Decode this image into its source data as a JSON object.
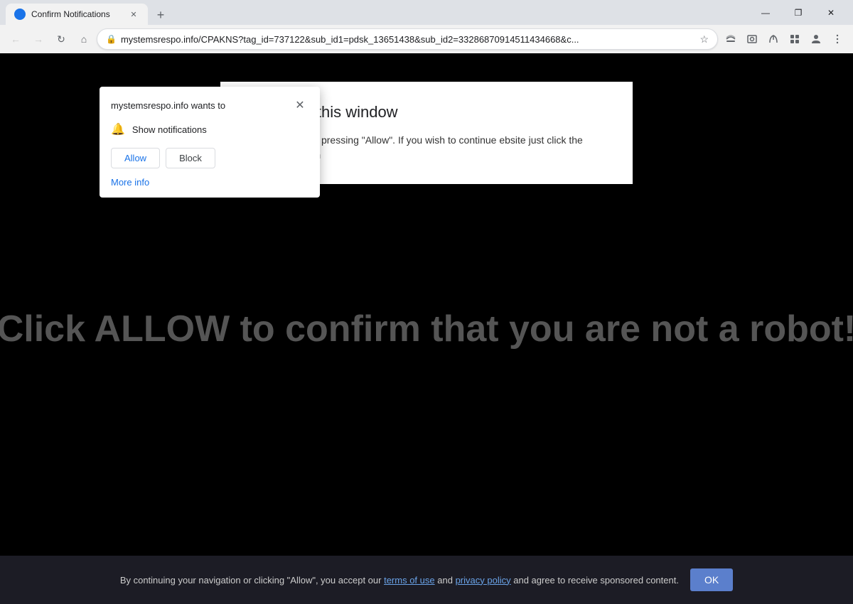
{
  "browser": {
    "tab_title": "Confirm Notifications",
    "tab_favicon": "circle",
    "url": "mystemsrespo.info/CPAKNS?tag_id=737122&sub_id1=pdsk_13651438&sub_id2=33286870914511434668&c...",
    "new_tab_label": "+",
    "win_minimize": "—",
    "win_maximize": "❐",
    "win_close": "✕"
  },
  "nav": {
    "back_icon": "←",
    "forward_icon": "→",
    "refresh_icon": "↻",
    "home_icon": "⌂",
    "lock_icon": "🔒",
    "star_icon": "☆"
  },
  "nav_icons": [
    {
      "name": "cast-icon",
      "glyph": "⬡"
    },
    {
      "name": "screenshot-icon",
      "glyph": "⬚"
    },
    {
      "name": "extensions-icon",
      "glyph": "⬡"
    },
    {
      "name": "profile-icon",
      "glyph": "👤"
    },
    {
      "name": "menu-icon",
      "glyph": "⋮"
    }
  ],
  "popup": {
    "site": "mystemsrespo.info wants to",
    "close_icon": "✕",
    "permission_icon": "🔔",
    "permission_text": "Show notifications",
    "allow_label": "Allow",
    "block_label": "Block",
    "more_info_label": "More info"
  },
  "content_box": {
    "title": "\" to close this window",
    "body": "an be closed by pressing \"Allow\". If you wish to continue\nebsite just click the more info button"
  },
  "page": {
    "big_text": "Click ALLOW to confirm that you are not a robot!"
  },
  "bottom_bar": {
    "text_before": "By continuing your navigation or clicking \"Allow\", you accept our",
    "terms_label": "terms of use",
    "and_text": "and",
    "privacy_label": "privacy policy",
    "text_after": "and agree to receive sponsored content.",
    "ok_label": "OK"
  }
}
